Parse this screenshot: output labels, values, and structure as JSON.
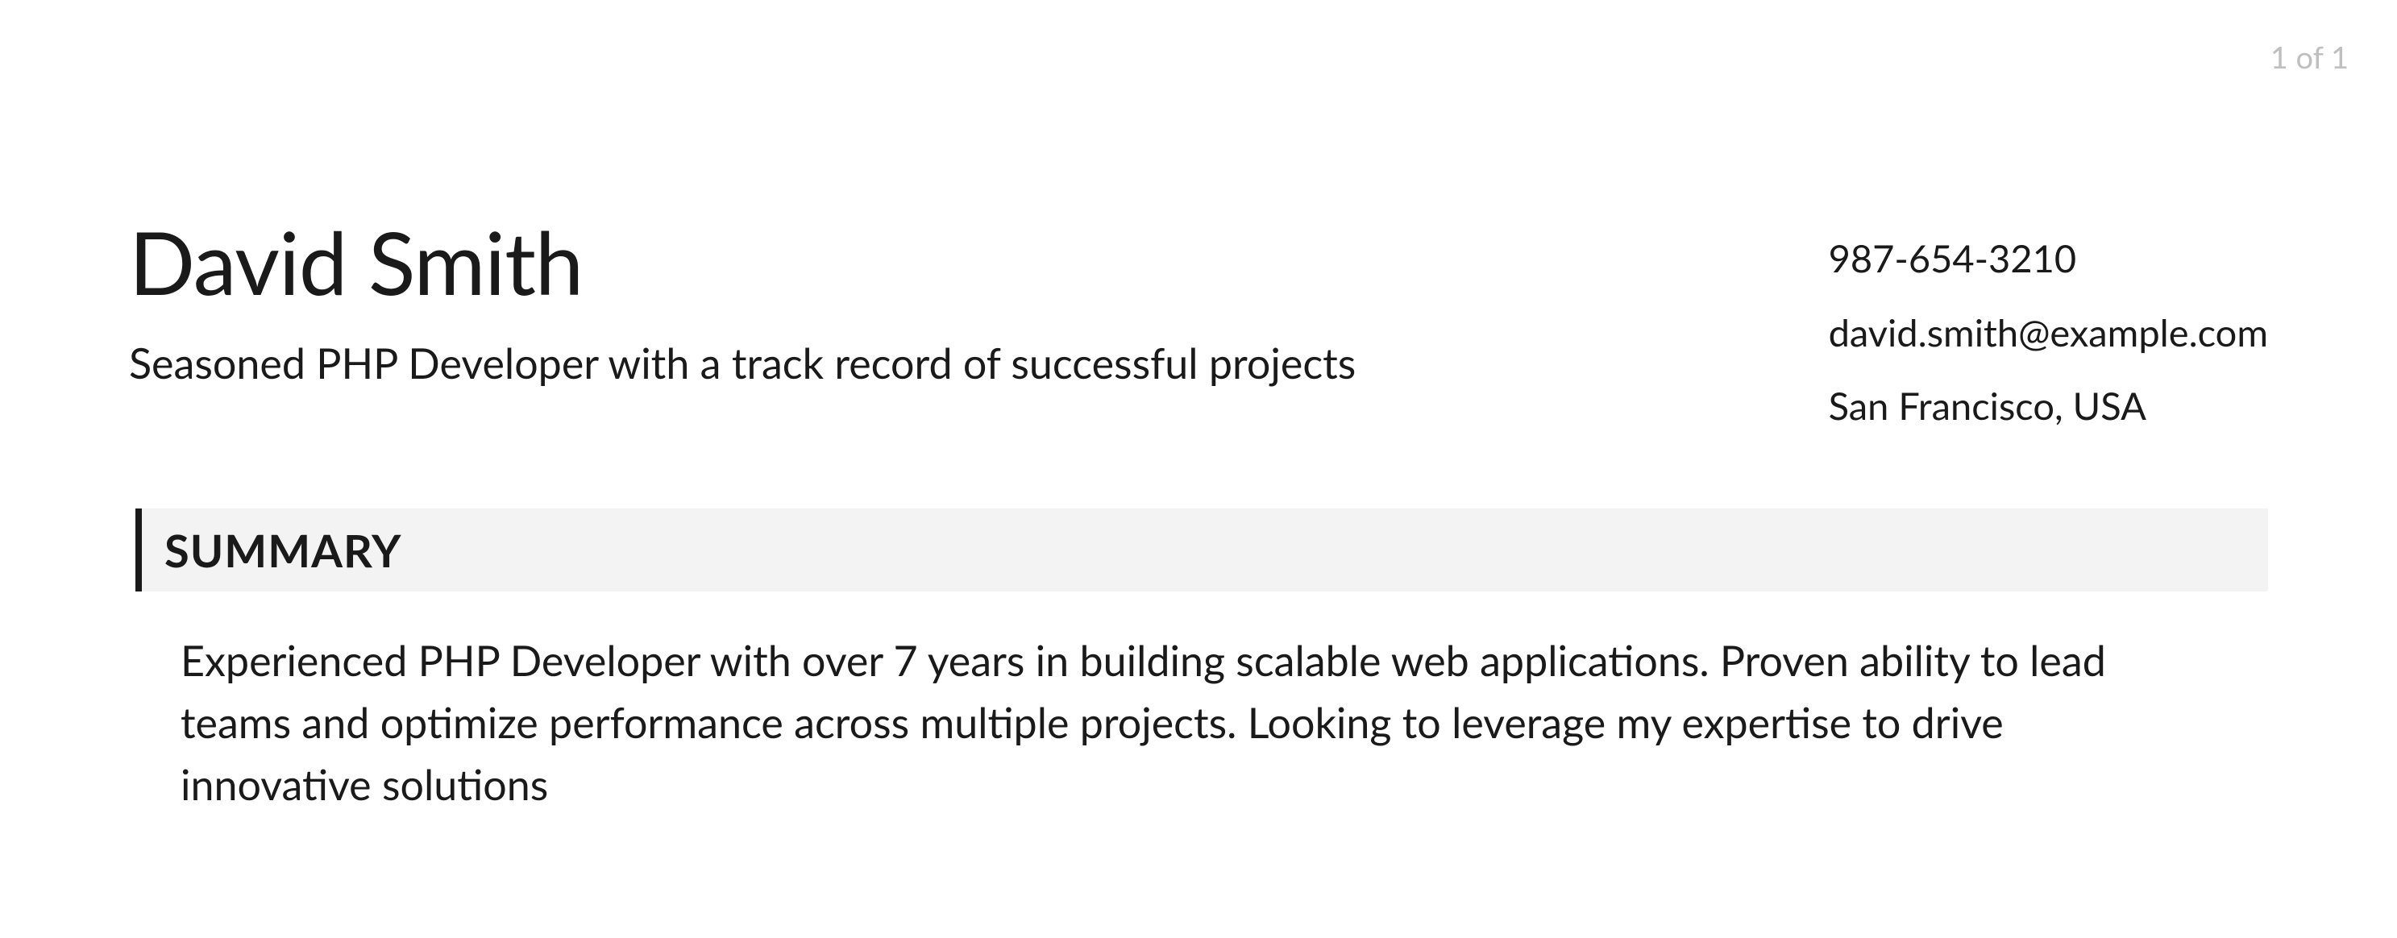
{
  "page_number": "1 of 1",
  "header": {
    "name": "David Smith",
    "tagline": "Seasoned PHP Developer with a track record of successful projects",
    "contact": {
      "phone": "987-654-3210",
      "email": "david.smith@example.com",
      "location": "San Francisco, USA"
    }
  },
  "summary": {
    "title": "SUMMARY",
    "text": "Experienced PHP Developer with over 7 years in building scalable web applications. Proven ability to lead teams and optimize performance across multiple projects. Looking to leverage my expertise to drive innovative solutions"
  }
}
